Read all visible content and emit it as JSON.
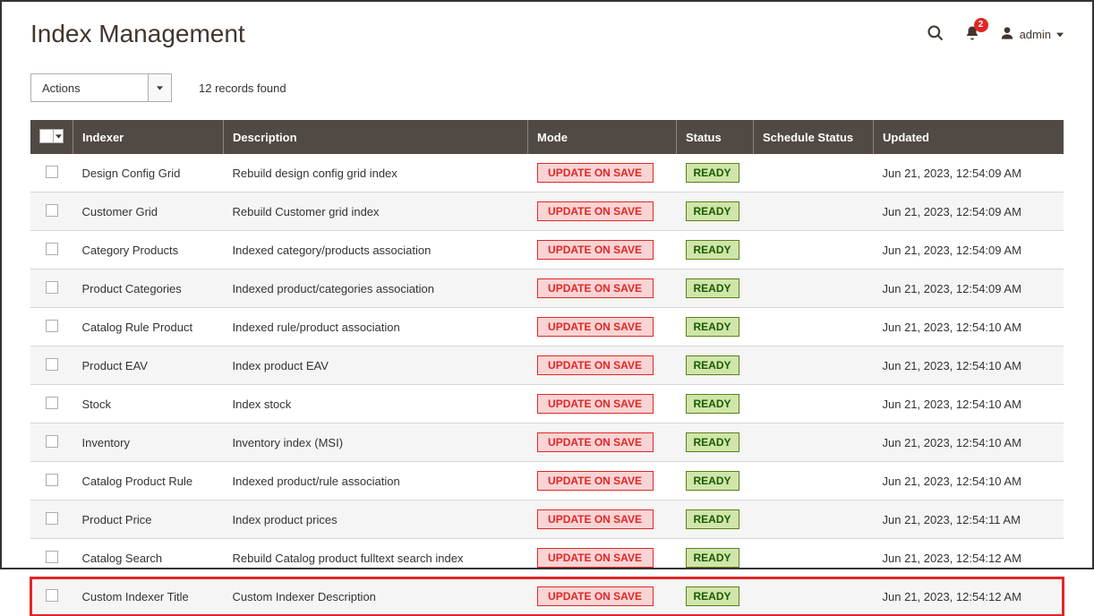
{
  "page_title": "Index Management",
  "notification_count": "2",
  "user_name": "admin",
  "actions_label": "Actions",
  "records_text": "12 records found",
  "columns": {
    "indexer": "Indexer",
    "description": "Description",
    "mode": "Mode",
    "status": "Status",
    "schedule_status": "Schedule Status",
    "updated": "Updated"
  },
  "mode_label": "UPDATE ON SAVE",
  "status_label": "READY",
  "rows": [
    {
      "indexer": "Design Config Grid",
      "description": "Rebuild design config grid index",
      "updated": "Jun 21, 2023, 12:54:09 AM"
    },
    {
      "indexer": "Customer Grid",
      "description": "Rebuild Customer grid index",
      "updated": "Jun 21, 2023, 12:54:09 AM"
    },
    {
      "indexer": "Category Products",
      "description": "Indexed category/products association",
      "updated": "Jun 21, 2023, 12:54:09 AM"
    },
    {
      "indexer": "Product Categories",
      "description": "Indexed product/categories association",
      "updated": "Jun 21, 2023, 12:54:09 AM"
    },
    {
      "indexer": "Catalog Rule Product",
      "description": "Indexed rule/product association",
      "updated": "Jun 21, 2023, 12:54:10 AM"
    },
    {
      "indexer": "Product EAV",
      "description": "Index product EAV",
      "updated": "Jun 21, 2023, 12:54:10 AM"
    },
    {
      "indexer": "Stock",
      "description": "Index stock",
      "updated": "Jun 21, 2023, 12:54:10 AM"
    },
    {
      "indexer": "Inventory",
      "description": "Inventory index (MSI)",
      "updated": "Jun 21, 2023, 12:54:10 AM"
    },
    {
      "indexer": "Catalog Product Rule",
      "description": "Indexed product/rule association",
      "updated": "Jun 21, 2023, 12:54:10 AM"
    },
    {
      "indexer": "Product Price",
      "description": "Index product prices",
      "updated": "Jun 21, 2023, 12:54:11 AM"
    },
    {
      "indexer": "Catalog Search",
      "description": "Rebuild Catalog product fulltext search index",
      "updated": "Jun 21, 2023, 12:54:12 AM"
    },
    {
      "indexer": "Custom Indexer Title",
      "description": "Custom Indexer Description",
      "updated": "Jun 21, 2023, 12:54:12 AM"
    }
  ]
}
